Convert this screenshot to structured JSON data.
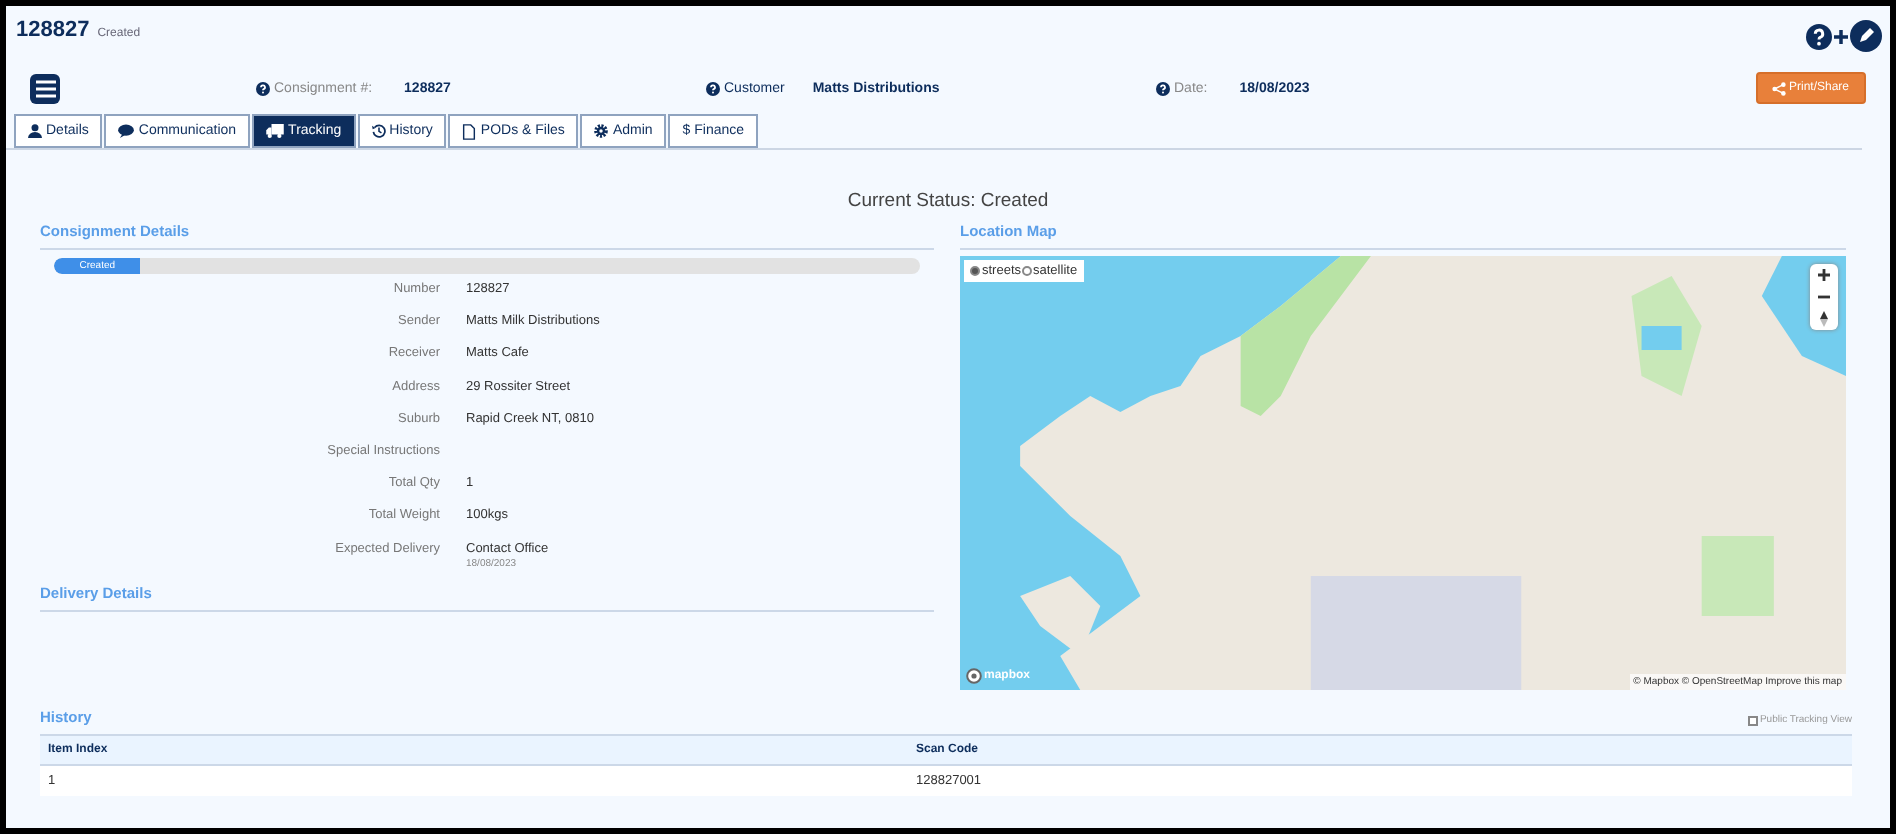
{
  "header": {
    "number": "128827",
    "status": "Created"
  },
  "info": [
    {
      "label": "Consignment #:",
      "value": "128827"
    },
    {
      "label": "Customer",
      "value": "Matts Distributions"
    },
    {
      "label": "Date:",
      "value": "18/08/2023"
    }
  ],
  "print_button": "Print/Share",
  "tabs": [
    {
      "label": "Details",
      "selected": false
    },
    {
      "label": "Communication",
      "selected": false
    },
    {
      "label": "Tracking",
      "selected": true
    },
    {
      "label": "History",
      "selected": false
    },
    {
      "label": "PODs & Files",
      "selected": false
    },
    {
      "label": "Admin",
      "selected": false
    },
    {
      "label": "$ Finance",
      "selected": false
    }
  ],
  "current_status": "Current Status: Created",
  "consignment_details": {
    "title": "Consignment Details",
    "progress": {
      "label": "Created",
      "level": 0.1
    },
    "fields": [
      {
        "label": "Number",
        "value": "128827"
      },
      {
        "label": "Sender",
        "value": "Matts Milk Distributions"
      },
      {
        "label": "Receiver",
        "value": "Matts Cafe"
      },
      {
        "label": "Address",
        "value": "29 Rossiter Street"
      },
      {
        "label": "Suburb",
        "value": "Rapid Creek NT, 0810"
      },
      {
        "label": "Special Instructions"
      },
      {
        "label": "Total Qty",
        "value": "1"
      },
      {
        "label": "Total Weight",
        "value": "100kgs"
      },
      {
        "label": "Expected Delivery",
        "value": "Contact Office",
        "note": "18/08/2023"
      }
    ]
  },
  "delivery_details": {
    "title": "Delivery Details"
  },
  "location_map": {
    "title": "Location Map",
    "layers": [
      {
        "label": "streets",
        "selected": true
      },
      {
        "label": "satellite",
        "selected": false
      }
    ],
    "logo": "mapbox",
    "attribution": "© Mapbox © OpenStreetMap Improve this map"
  },
  "history": {
    "title": "History",
    "public_tracking": {
      "label": "Public Tracking View",
      "checked": false
    },
    "columns": [
      "Item Index",
      "Scan Code"
    ],
    "rows": [
      [
        "1",
        "128827001"
      ]
    ]
  }
}
